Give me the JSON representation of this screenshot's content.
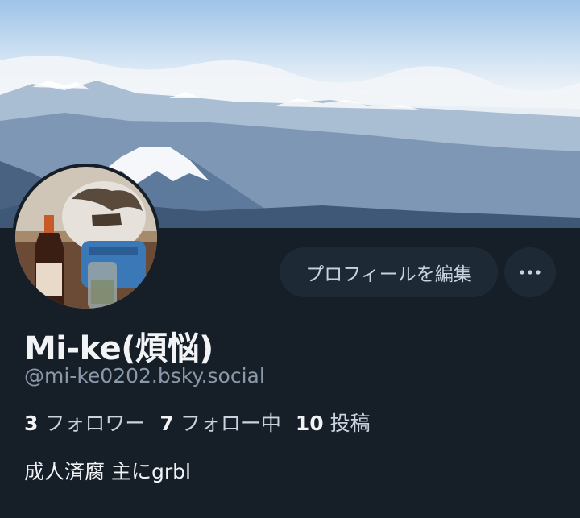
{
  "profile": {
    "display_name": "Mi-ke(煩悩)",
    "handle": "@mi-ke0202.bsky.social",
    "bio": "成人済腐 主にgrbl",
    "stats": {
      "followers_count": "3",
      "followers_label": "フォロワー",
      "following_count": "7",
      "following_label": "フォロー中",
      "posts_count": "10",
      "posts_label": "投稿"
    }
  },
  "actions": {
    "edit_profile_label": "プロフィールを編集",
    "more_icon": "ellipsis-icon"
  },
  "colors": {
    "background": "#161e27",
    "button_bg": "#1e2936",
    "muted_text": "#8a99aa"
  }
}
